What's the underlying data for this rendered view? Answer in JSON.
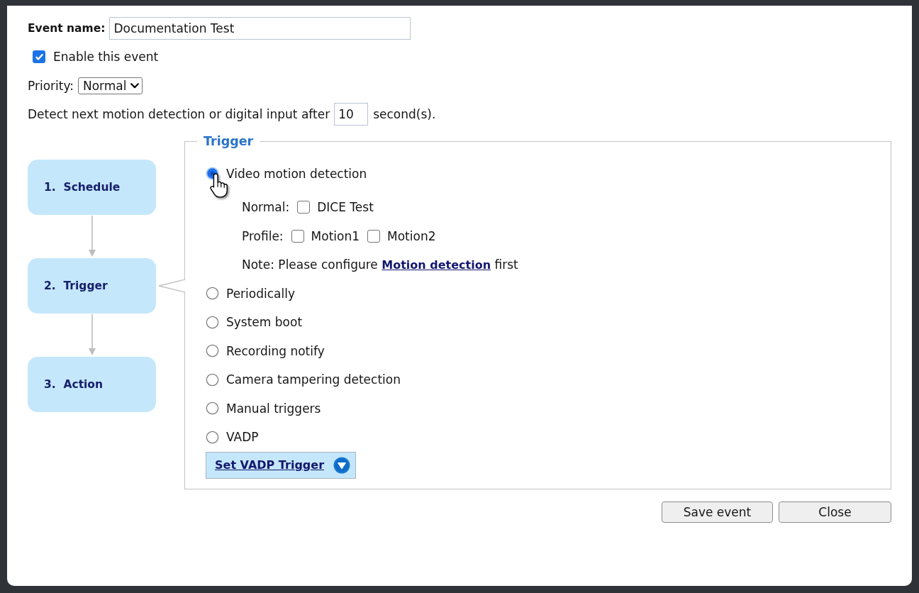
{
  "event_name": {
    "label": "Event name:",
    "value": "Documentation Test"
  },
  "enable_event": {
    "label": "Enable this event",
    "checked": true
  },
  "priority": {
    "label": "Priority:",
    "value": "Normal"
  },
  "detect_interval": {
    "label_before": "Detect next motion detection or digital input after",
    "value": "10",
    "label_after": "second(s)."
  },
  "steps": [
    {
      "label": "1.  Schedule",
      "selected": false
    },
    {
      "label": "2.  Trigger",
      "selected": true
    },
    {
      "label": "3.  Action",
      "selected": false
    }
  ],
  "trigger": {
    "title": "Trigger",
    "options": [
      {
        "label": "Video motion detection",
        "selected": true,
        "hovered": true,
        "sub_rows": [
          {
            "kind": "checkboxes",
            "label": "Normal:",
            "items": [
              {
                "label": "DICE Test",
                "checked": false
              }
            ]
          },
          {
            "kind": "checkboxes",
            "label": "Profile:",
            "items": [
              {
                "label": "Motion1",
                "checked": false
              },
              {
                "label": "Motion2",
                "checked": false
              }
            ]
          },
          {
            "kind": "note",
            "text": "Note: Please configure",
            "link": "Motion detection",
            "text_after": "first"
          }
        ]
      },
      {
        "label": "Periodically",
        "selected": false,
        "hovered": false
      },
      {
        "label": "System boot",
        "selected": false,
        "hovered": false
      },
      {
        "label": "Recording notify",
        "selected": false,
        "hovered": false
      },
      {
        "label": "Camera tampering detection",
        "selected": false,
        "hovered": false
      },
      {
        "label": "Manual triggers",
        "selected": false,
        "hovered": false
      },
      {
        "label": "VADP",
        "selected": false,
        "hovered": false,
        "button": "Set VADP Trigger"
      }
    ]
  },
  "buttons": [
    {
      "label": "Save event"
    },
    {
      "label": "Close"
    }
  ]
}
